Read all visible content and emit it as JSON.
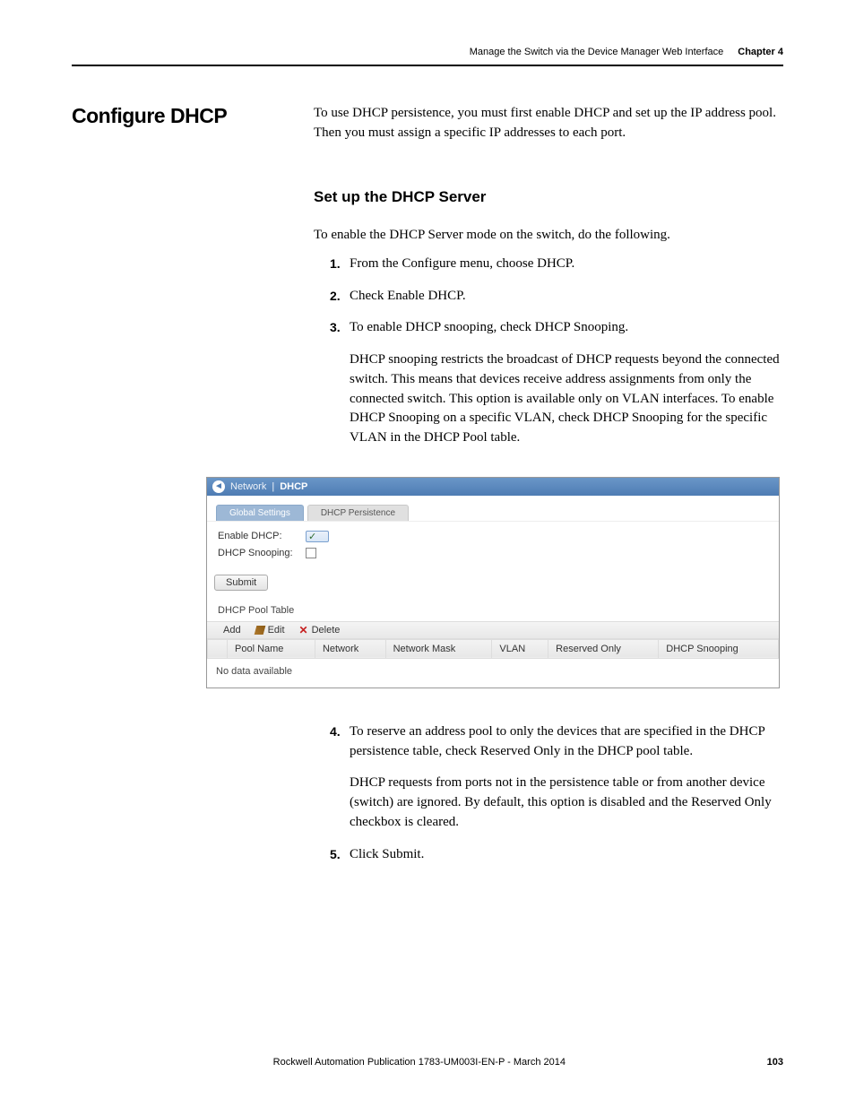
{
  "header": {
    "running_title": "Manage the Switch via the Device Manager Web Interface",
    "chapter_label": "Chapter 4"
  },
  "section_title": "Configure DHCP",
  "intro_paragraph": "To use DHCP persistence, you must first enable DHCP and set up the IP address pool. Then you must assign a specific IP addresses to each port.",
  "subheading": "Set up the DHCP Server",
  "lead_sentence": "To enable the DHCP Server mode on the switch, do the following.",
  "steps_a": [
    {
      "num": "1.",
      "text": "From the Configure menu, choose DHCP."
    },
    {
      "num": "2.",
      "text": "Check Enable DHCP."
    },
    {
      "num": "3.",
      "text": "To enable DHCP snooping, check DHCP Snooping.",
      "followup": "DHCP snooping restricts the broadcast of DHCP requests beyond the connected switch. This means that devices receive address assignments from only the connected switch. This option is available only on VLAN interfaces. To enable DHCP Snooping on a specific VLAN, check DHCP Snooping for the specific VLAN in the DHCP Pool table."
    }
  ],
  "steps_b": [
    {
      "num": "4.",
      "text": "To reserve an address pool to only the devices that are specified in the DHCP persistence table, check Reserved Only in the DHCP pool table.",
      "followup": "DHCP requests from ports not in the persistence table or from another device (switch) are ignored. By default, this option is disabled and the Reserved Only checkbox is cleared."
    },
    {
      "num": "5.",
      "text": "Click Submit."
    }
  ],
  "ui": {
    "breadcrumb_parent": "Network",
    "breadcrumb_sep": "|",
    "breadcrumb_current": "DHCP",
    "tabs": {
      "active": "Global Settings",
      "other": "DHCP Persistence"
    },
    "form": {
      "enable_dhcp_label": "Enable DHCP:",
      "dhcp_snooping_label": "DHCP Snooping:",
      "submit": "Submit"
    },
    "pool_section_label": "DHCP Pool Table",
    "toolbar": {
      "add": "Add",
      "edit": "Edit",
      "delete": "Delete"
    },
    "columns": [
      "",
      "Pool Name",
      "Network",
      "Network Mask",
      "VLAN",
      "Reserved Only",
      "DHCP Snooping"
    ],
    "empty_text": "No data available"
  },
  "footer": {
    "publication": "Rockwell Automation Publication 1783-UM003I-EN-P - March 2014",
    "page_number": "103"
  }
}
